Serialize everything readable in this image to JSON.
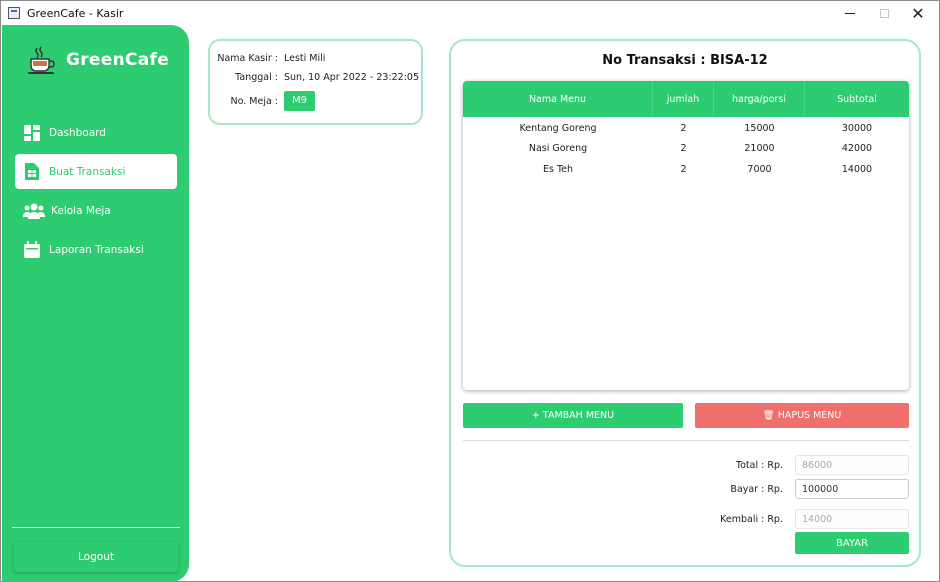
{
  "window": {
    "title": "GreenCafe - Kasir"
  },
  "sidebar": {
    "brand": "GreenCafe",
    "brand_icon": "coffee-cup-icon",
    "items": [
      {
        "label": "Dashboard",
        "icon": "dashboard-icon",
        "active": false
      },
      {
        "label": "Buat Transaksi",
        "icon": "receipt-icon",
        "active": true
      },
      {
        "label": "Kelola Meja",
        "icon": "users-icon",
        "active": false
      },
      {
        "label": "Laporan Transaksi",
        "icon": "calendar-icon",
        "active": false
      }
    ],
    "logout_label": "Logout"
  },
  "info": {
    "kasir_label": "Nama Kasir :",
    "kasir_value": "Lesti Mili",
    "tanggal_label": "Tanggal :",
    "tanggal_value": "Sun, 10 Apr 2022 - 23:22:05",
    "meja_label": "No. Meja :",
    "meja_value": "M9"
  },
  "transaction": {
    "title": "No Transaksi :  BISA-12",
    "columns": [
      "Nama Menu",
      "jumlah",
      "harga/porsi",
      "Subtotal"
    ],
    "rows": [
      [
        "Kentang Goreng",
        "2",
        "15000",
        "30000"
      ],
      [
        "Nasi Goreng",
        "2",
        "21000",
        "42000"
      ],
      [
        "Es Teh",
        "2",
        "7000",
        "14000"
      ]
    ],
    "tambah_label": "+ TAMBAH MENU",
    "hapus_label": "🗑 HAPUS MENU",
    "total_label": "Total : Rp.",
    "total_value": "86000",
    "bayar_label": "Bayar : Rp.",
    "bayar_value": "100000",
    "kembali_label": "Kembali : Rp.",
    "kembali_value": "14000",
    "bayar_button": "BAYAR"
  },
  "colors": {
    "accent": "#2ecc71",
    "danger": "#ef6f6c",
    "border": "#a6e8c1"
  }
}
